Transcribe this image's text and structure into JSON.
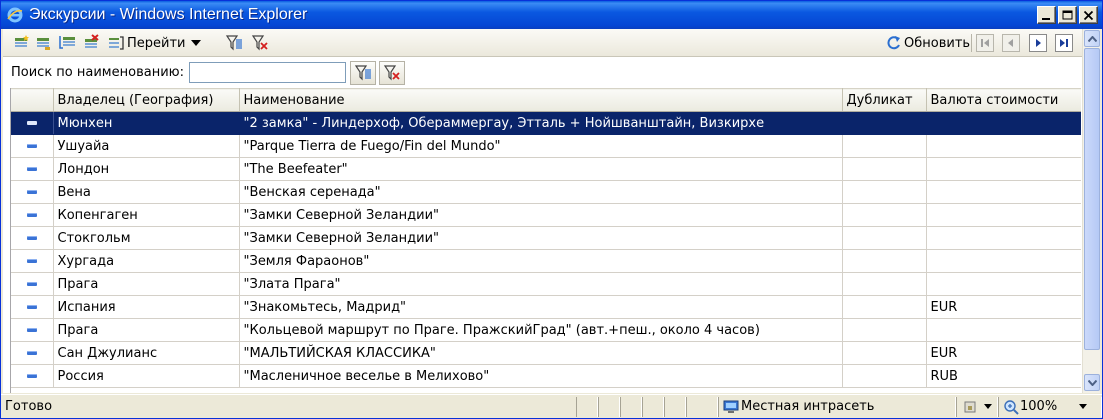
{
  "window": {
    "title": "Экскурсии - Windows Internet Explorer"
  },
  "toolbar": {
    "goto_label": "Перейти",
    "refresh_label": "Обновить"
  },
  "search": {
    "label": "Поиск по наименованию:",
    "value": ""
  },
  "grid": {
    "columns": [
      "",
      "Владелец (География)",
      "Наименование",
      "Дубликат",
      "Валюта стоимости"
    ],
    "selected_row": 0,
    "rows": [
      {
        "owner": "Мюнхен",
        "name": "\"2 замка\" - Линдерхоф, Обераммергау, Этталь + Нойшванштайн, Визкирхе",
        "duplicate": "",
        "currency": ""
      },
      {
        "owner": "Ушуайа",
        "name": "\"Parque Tierra de Fuego/Fin del Mundo\"",
        "duplicate": "",
        "currency": ""
      },
      {
        "owner": "Лондон",
        "name": "\"The Beefeater\"",
        "duplicate": "",
        "currency": ""
      },
      {
        "owner": "Вена",
        "name": "\"Венская серенада\"",
        "duplicate": "",
        "currency": ""
      },
      {
        "owner": "Копенгаген",
        "name": "\"Замки Северной Зеландии\"",
        "duplicate": "",
        "currency": ""
      },
      {
        "owner": "Стокгольм",
        "name": "\"Замки Северной Зеландии\"",
        "duplicate": "",
        "currency": ""
      },
      {
        "owner": "Хургада",
        "name": "\"Земля Фараонов\"",
        "duplicate": "",
        "currency": ""
      },
      {
        "owner": "Прага",
        "name": "\"Злата Прага\"",
        "duplicate": "",
        "currency": ""
      },
      {
        "owner": "Испания",
        "name": "\"Знакомьтесь, Мадрид\"",
        "duplicate": "",
        "currency": "EUR"
      },
      {
        "owner": "Прага",
        "name": "\"Кольцевой маршрут по Праге. ПражскийГрад\" (авт.+пеш., около 4 часов)",
        "duplicate": "",
        "currency": ""
      },
      {
        "owner": "Сан Джулианс",
        "name": "\"МАЛЬТИЙСКАЯ КЛАССИКА\"",
        "duplicate": "",
        "currency": "EUR"
      },
      {
        "owner": "Россия",
        "name": "\"Масленичное веселье в Мелихово\"",
        "duplicate": "",
        "currency": "RUB"
      }
    ]
  },
  "status": {
    "text": "Готово",
    "zone": "Местная интрасеть",
    "zoom": "100%"
  },
  "colors": {
    "title_bar": "#0a58e0",
    "selection": "#0a246a",
    "row_marker": "#3a73d6"
  }
}
